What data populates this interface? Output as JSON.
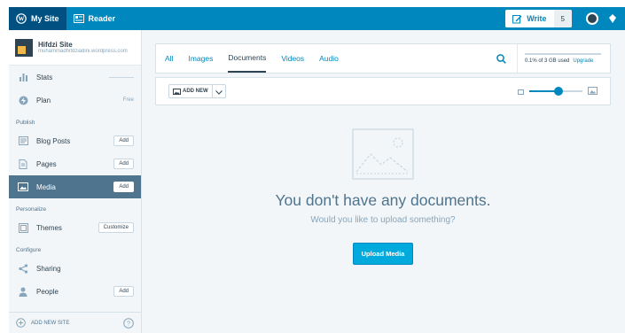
{
  "masterbar": {
    "my_site": "My Site",
    "reader": "Reader",
    "write": "Write",
    "write_count": "5"
  },
  "site": {
    "name": "Hifdzi Site",
    "url": "muhammadhifdziadini.wordpress.com"
  },
  "sidebar": {
    "stats": "Stats",
    "plan": "Plan",
    "plan_note": "Free",
    "heading_publish": "Publish",
    "blog_posts": "Blog Posts",
    "pages": "Pages",
    "media": "Media",
    "add": "Add",
    "heading_personalize": "Personalize",
    "themes": "Themes",
    "customize": "Customize",
    "heading_configure": "Configure",
    "sharing": "Sharing",
    "people": "People",
    "add_new_site": "ADD NEW SITE"
  },
  "filter": {
    "tabs": [
      "All",
      "Images",
      "Documents",
      "Videos",
      "Audio"
    ],
    "active_tab": "Documents",
    "storage_text": "0.1% of 3 GB used",
    "upgrade": "Upgrade"
  },
  "toolbar": {
    "add_new": "ADD NEW"
  },
  "empty": {
    "title": "You don't have any documents.",
    "subtitle": "Would you like to upload something?",
    "button": "Upload Media"
  },
  "colors": {
    "masterbar": "#0087be",
    "accent": "#00aadc",
    "selected": "#4f748e"
  },
  "thumbnail_size": 0.55,
  "storage_used": 0.001
}
